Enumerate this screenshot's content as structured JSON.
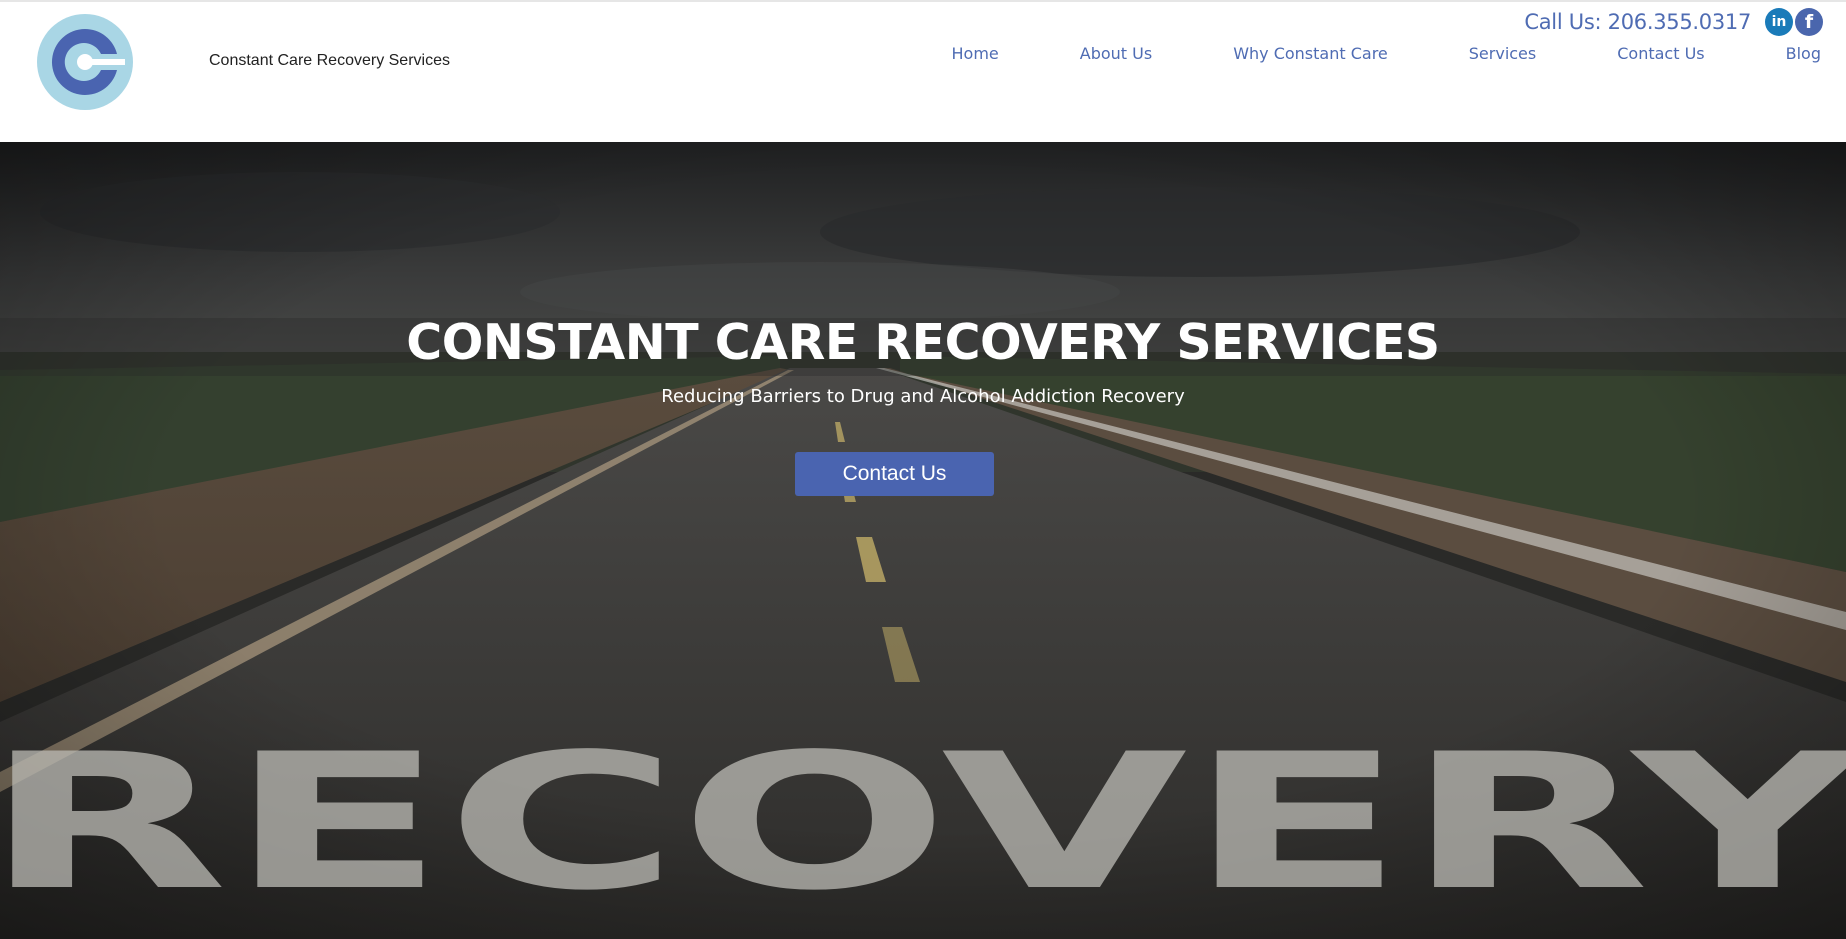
{
  "header": {
    "site_name": "Constant Care Recovery Services",
    "phone_label": "Call Us:",
    "phone_number": "206.355.0317",
    "social": {
      "linkedin_glyph": "in",
      "facebook_glyph": "f"
    }
  },
  "nav": {
    "items": [
      {
        "label": "Home"
      },
      {
        "label": "About Us"
      },
      {
        "label": "Why Constant Care"
      },
      {
        "label": "Services"
      },
      {
        "label": "Contact Us"
      },
      {
        "label": "Blog"
      }
    ]
  },
  "hero": {
    "title": "CONSTANT CARE RECOVERY SERVICES",
    "subtitle": "Reducing Barriers to Drug and Alcohol Addiction Recovery",
    "cta_label": "Contact Us",
    "road_text": "RECOVERY"
  },
  "colors": {
    "accent": "#4f6cb3",
    "button": "#4a64b0",
    "logo_light": "#a9d6e5",
    "logo_dark": "#4a64b0",
    "linkedin": "#1a7bb9",
    "facebook": "#4a66ad"
  },
  "icons": {
    "logo": "cc-logo-icon",
    "linkedin": "linkedin-icon",
    "facebook": "facebook-icon"
  }
}
